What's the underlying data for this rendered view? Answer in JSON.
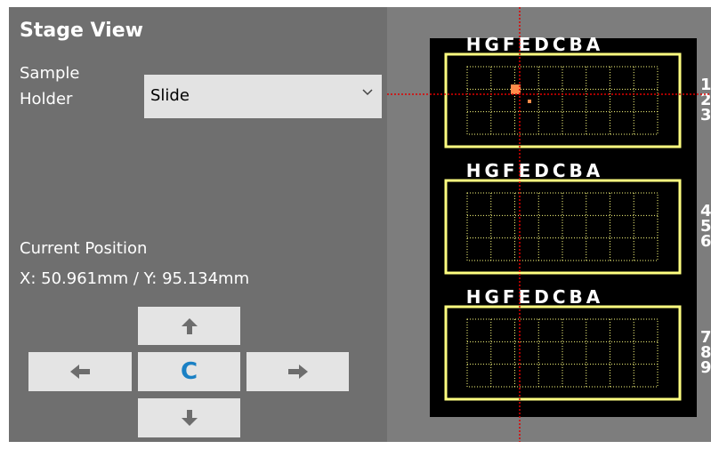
{
  "title": "Stage View",
  "sample_holder": {
    "label_line1": "Sample",
    "label_line2": "Holder",
    "selected": "Slide"
  },
  "position": {
    "label": "Current Position",
    "readout": "X: 50.961mm / Y: 95.134mm"
  },
  "jog": {
    "center_label": "C"
  },
  "stage": {
    "slides": [
      {
        "columns": [
          "H",
          "G",
          "F",
          "E",
          "D",
          "C",
          "B",
          "A"
        ],
        "rows": [
          "1",
          "2",
          "3"
        ]
      },
      {
        "columns": [
          "H",
          "G",
          "F",
          "E",
          "D",
          "C",
          "B",
          "A"
        ],
        "rows": [
          "4",
          "5",
          "6"
        ]
      },
      {
        "columns": [
          "H",
          "G",
          "F",
          "E",
          "D",
          "C",
          "B",
          "A"
        ],
        "rows": [
          "7",
          "8",
          "9"
        ]
      }
    ],
    "colors": {
      "frame": "#ffff80",
      "grid": "#ffff80",
      "crosshair": "#e00000",
      "marker": "#ff8c4a",
      "background": "#000000"
    }
  }
}
